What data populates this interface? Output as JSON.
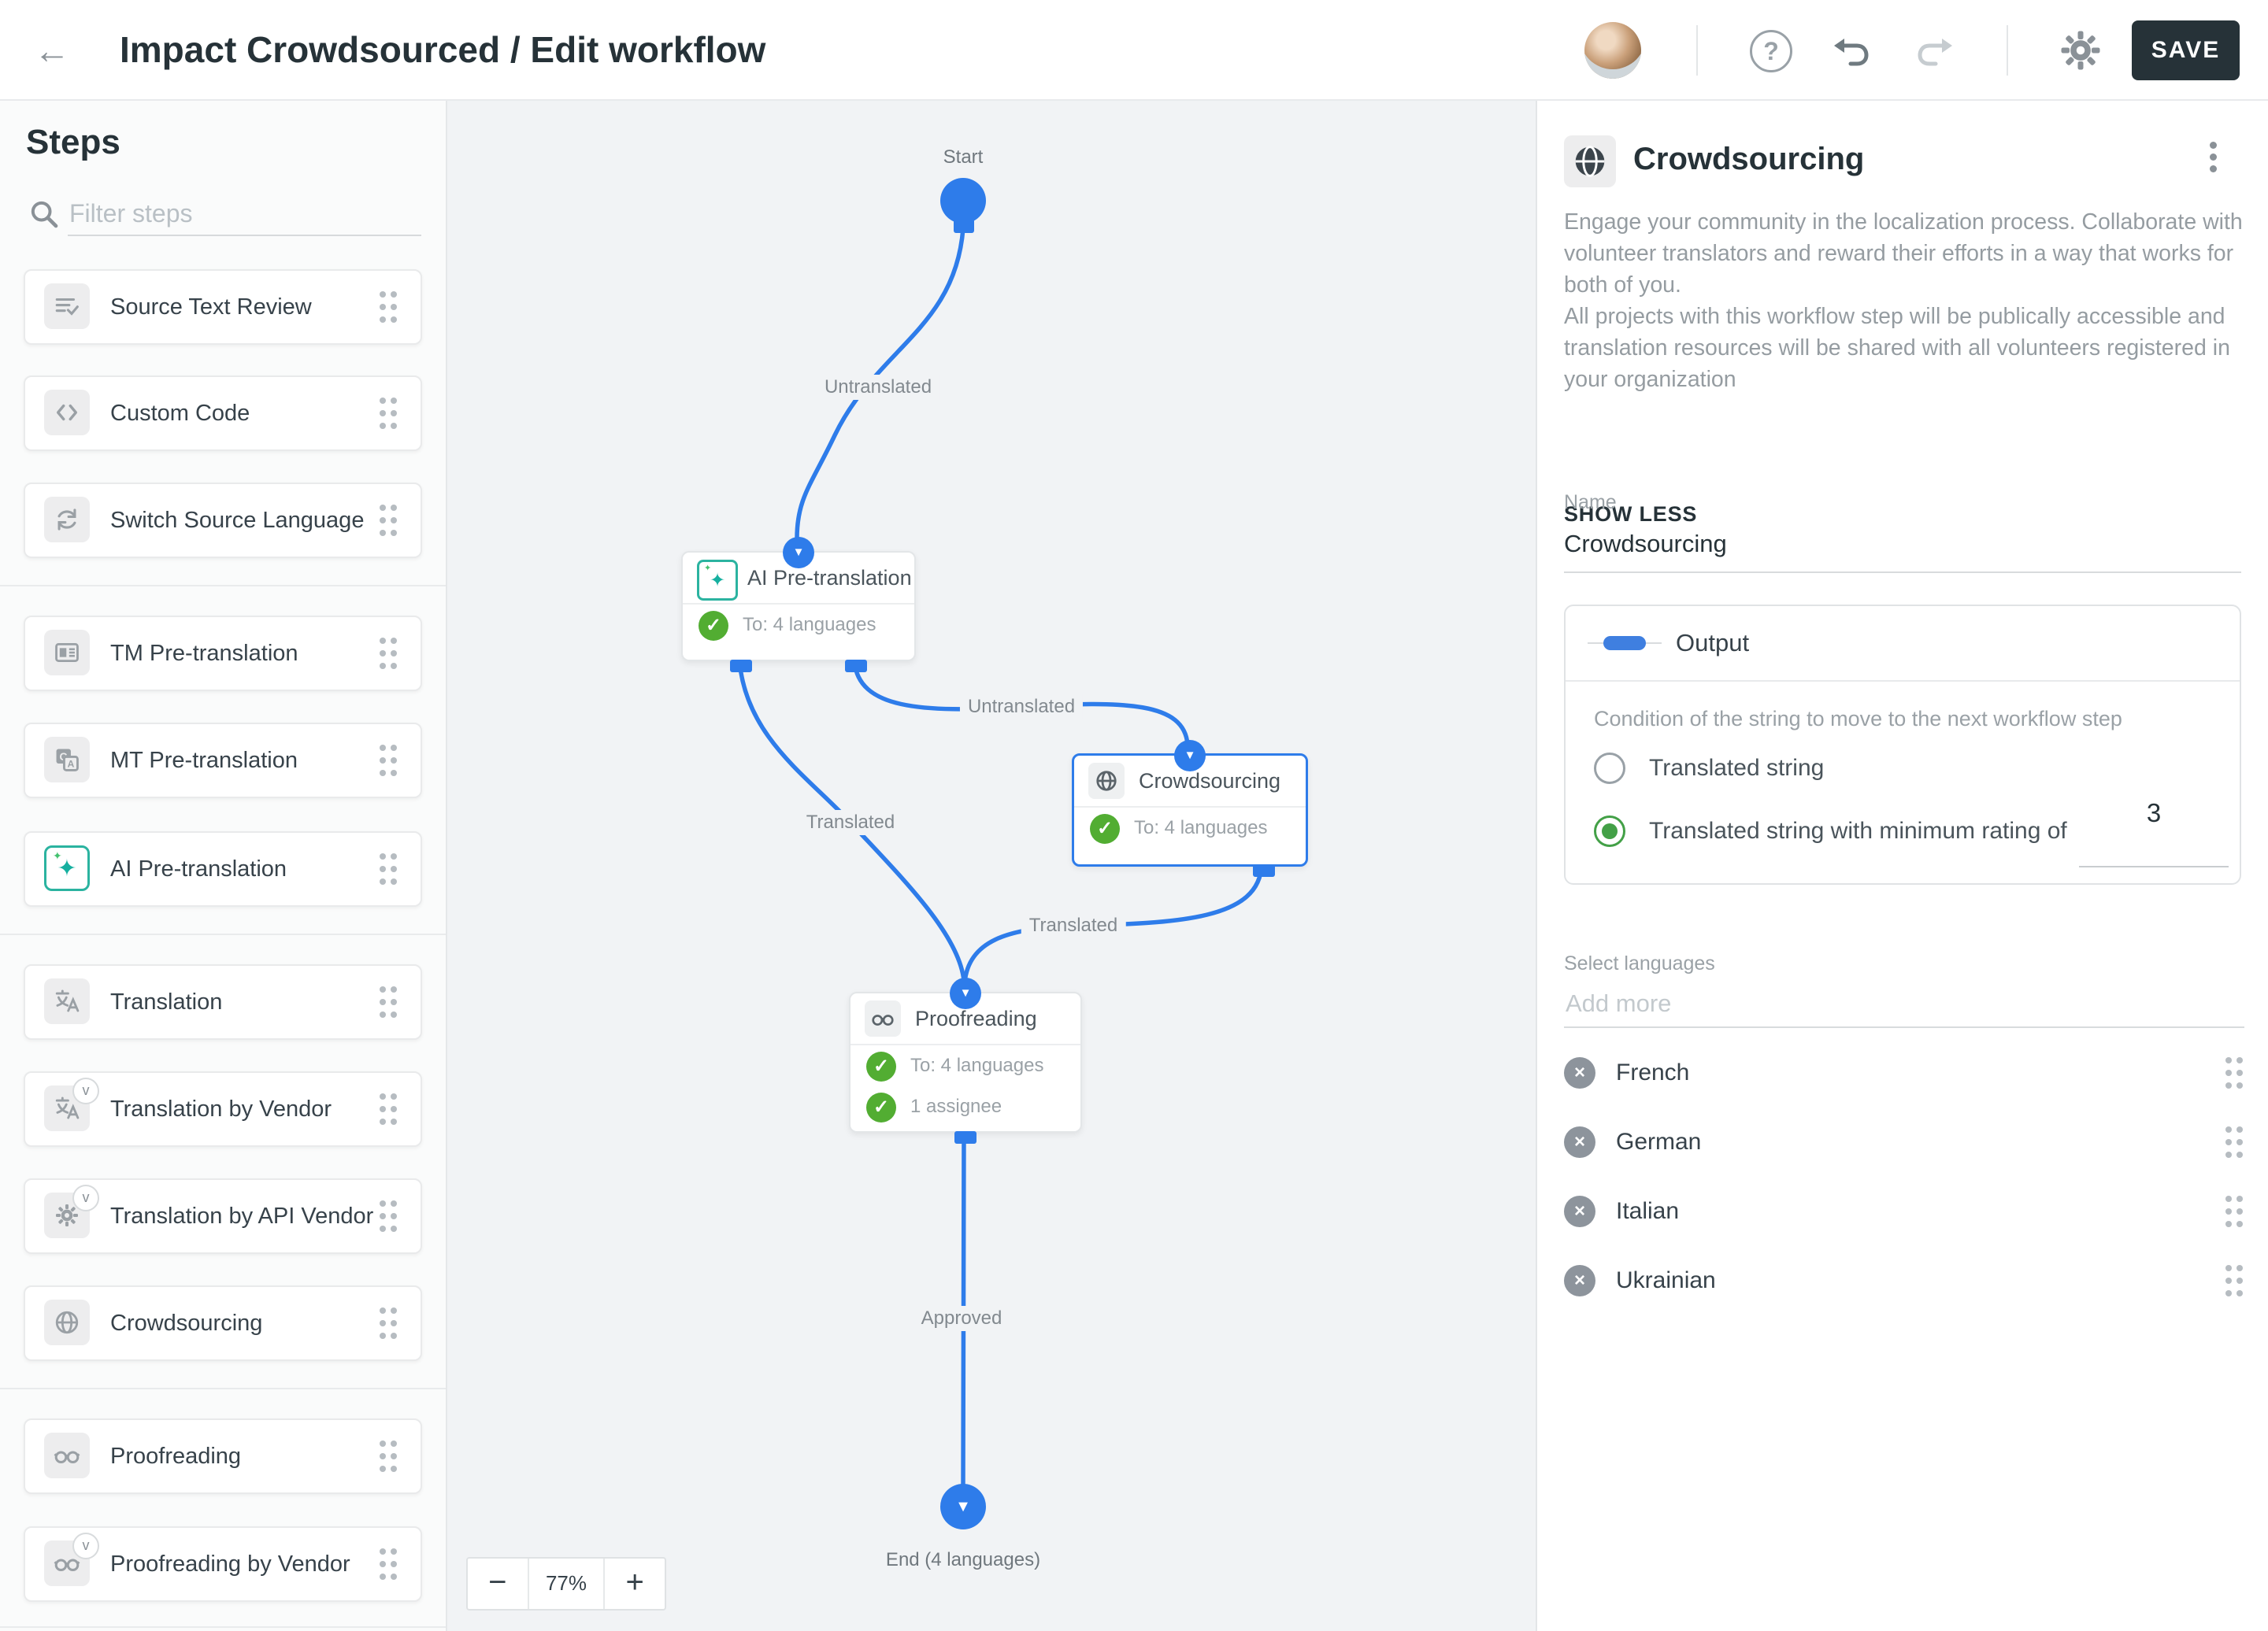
{
  "colors": {
    "blue": "#2e7cea",
    "green": "#52ad32",
    "radio_green": "#43a047",
    "dark": "#263238",
    "canvas_bg": "#f1f3f5"
  },
  "topbar": {
    "title": "Impact Crowdsourced / Edit workflow",
    "save_label": "SAVE"
  },
  "sidebar": {
    "title": "Steps",
    "filter_placeholder": "Filter steps",
    "items": [
      {
        "label": "Source Text Review",
        "icon": "source-text-review-icon",
        "vendor": false
      },
      {
        "label": "Custom Code",
        "icon": "code-icon",
        "vendor": false
      },
      {
        "label": "Switch Source Language",
        "icon": "switch-language-icon",
        "vendor": false
      },
      {
        "label": "TM Pre-translation",
        "icon": "tm-card-icon",
        "vendor": false
      },
      {
        "label": "MT Pre-translation",
        "icon": "machine-translate-icon",
        "vendor": false
      },
      {
        "label": "AI Pre-translation",
        "icon": "ai-sparkle-icon",
        "vendor": false
      },
      {
        "label": "Translation",
        "icon": "translate-icon",
        "vendor": false
      },
      {
        "label": "Translation by Vendor",
        "icon": "translate-icon",
        "vendor": true
      },
      {
        "label": "Translation by API Vendor",
        "icon": "gear-icon",
        "vendor": true
      },
      {
        "label": "Crowdsourcing",
        "icon": "globe-icon",
        "vendor": false
      },
      {
        "label": "Proofreading",
        "icon": "glasses-icon",
        "vendor": false
      },
      {
        "label": "Proofreading by Vendor",
        "icon": "glasses-icon",
        "vendor": true
      }
    ]
  },
  "canvas": {
    "start_label": "Start",
    "end_label": "End (4 languages)",
    "zoom_out": "−",
    "zoom_value": "77%",
    "zoom_in": "+",
    "nodes": {
      "ai": {
        "title": "AI Pre-translation",
        "badge1": "To: 4 languages"
      },
      "crowd": {
        "title": "Crowdsourcing",
        "badge1": "To: 4 languages"
      },
      "proof": {
        "title": "Proofreading",
        "badge1": "To: 4 languages",
        "badge2": "1 assignee"
      }
    },
    "edges": {
      "start_ai": "Untranslated",
      "ai_crowd": "Untranslated",
      "ai_proof": "Translated",
      "crowd_proof": "Translated",
      "proof_end": "Approved"
    }
  },
  "panel": {
    "title": "Crowdsourcing",
    "description_1": "Engage your community in the localization process. Collaborate with volunteer translators and reward their efforts in a way that works for both of you.",
    "description_2": "All projects with this workflow step will be publically accessible and translation resources will be shared with all volunteers registered in your organization",
    "show_less": "SHOW LESS",
    "name_label": "Name",
    "name_value": "Crowdsourcing",
    "output": {
      "title": "Output",
      "condition_label": "Condition of the string to move to the next workflow step",
      "option1": "Translated string",
      "option2": "Translated string with minimum rating of",
      "min_rating": "3"
    },
    "languages": {
      "label": "Select languages",
      "placeholder": "Add more",
      "items": [
        "French",
        "German",
        "Italian",
        "Ukrainian"
      ]
    }
  }
}
